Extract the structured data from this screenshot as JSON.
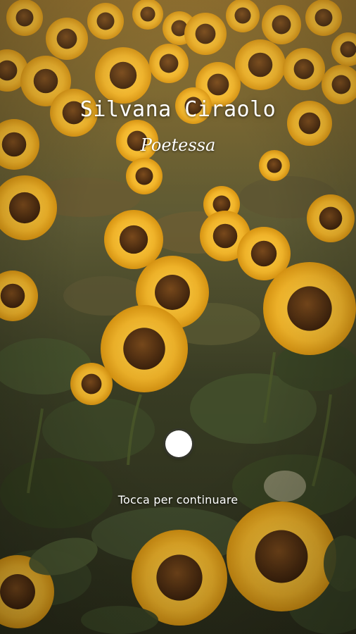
{
  "screen": {
    "title": "Silvana Ciraolo",
    "subtitle": "Poetessa",
    "cta_text": "Tocca per continuare",
    "background_image": "sunflower-field",
    "colors": {
      "text": "#ffffff",
      "sunflower_petal": "#f2b52a",
      "sunflower_center": "#5a3414",
      "foliage": "#3e4a2a"
    }
  }
}
